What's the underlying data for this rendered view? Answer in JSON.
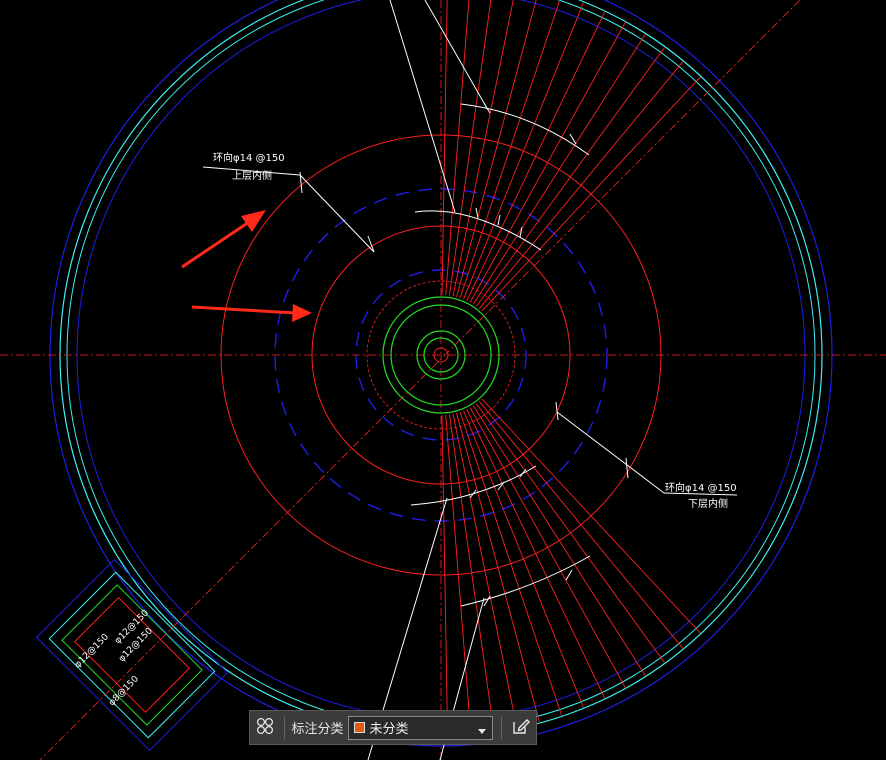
{
  "drawing": {
    "label_top_line1": "环向φ14 @150",
    "label_top_line2": "上层内侧",
    "label_right_line1": "环向φ14 @150",
    "label_right_line2": "下层内侧",
    "annex_label_1": "φ12@150",
    "annex_label_2": "φ12@150",
    "annex_label_3": "φ12@150",
    "annex_label_4": "φ8@150"
  },
  "toolbar": {
    "category_label": "标注分类",
    "category_value": "未分类",
    "swatch_color": "#e05a14",
    "icons": [
      "grid-icon",
      "chevron-down-icon",
      "edit-icon"
    ]
  },
  "colors": {
    "background": "#000000",
    "outer_wall": "#1e1ee6",
    "inner_wall": "#3cf0f0",
    "rebar": "#ff2020",
    "dimension": "#ffffff",
    "center_rings": "#22dd22",
    "annotation_arrow": "#ff2a1a"
  }
}
